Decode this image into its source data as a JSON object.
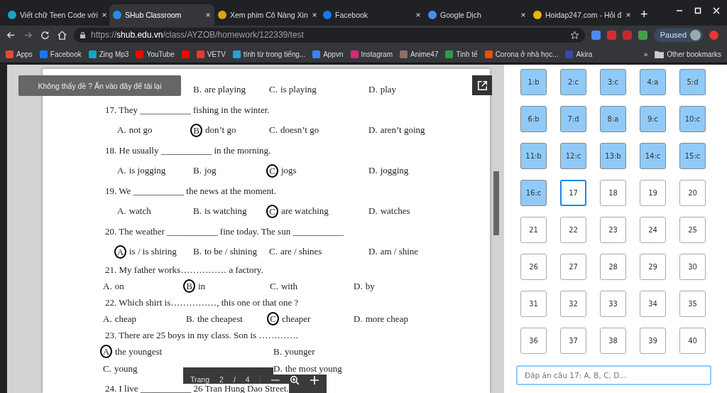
{
  "tabs": [
    {
      "title": "Viết chữ Teen Code với",
      "selected": false
    },
    {
      "title": "SHub Classroom",
      "selected": true
    },
    {
      "title": "Xem phim Cô Nàng Xin",
      "selected": false
    },
    {
      "title": "Facebook",
      "selected": false
    },
    {
      "title": "Google Dịch",
      "selected": false
    },
    {
      "title": "Hoidap247.com - Hỏi đ",
      "selected": false
    }
  ],
  "new_tab": "+",
  "address": {
    "scheme": "https://",
    "host": "shub.edu.vn",
    "path": "/class/AYZOB/homework/122339/test"
  },
  "profile": {
    "label": "Paused"
  },
  "bookmarks": [
    {
      "kind": "labeled",
      "label": "Apps"
    },
    {
      "kind": "labeled",
      "label": "Facebook"
    },
    {
      "kind": "labeled",
      "label": "Zing Mp3"
    },
    {
      "kind": "labeled",
      "label": "YouTube"
    },
    {
      "kind": "icon-only"
    },
    {
      "kind": "labeled",
      "label": "VETV"
    },
    {
      "kind": "labeled",
      "label": "tính từ trong tiếng..."
    },
    {
      "kind": "labeled",
      "label": "Appvn"
    },
    {
      "kind": "labeled",
      "label": "Instagram"
    },
    {
      "kind": "labeled",
      "label": "Anime47"
    },
    {
      "kind": "labeled",
      "label": "Tinh tế"
    },
    {
      "kind": "labeled",
      "label": "Corona ở nhà học..."
    },
    {
      "kind": "labeled",
      "label": "Akira"
    }
  ],
  "bookmarks_more": "»",
  "other_bookmarks": "Other bookmarks",
  "toast": "Không thấy đề ? Ấn vào đây để tải lại",
  "questions": [
    {
      "kind": "four-cut",
      "options": [
        {
          "label": "B.",
          "text": "are playing",
          "circled": false
        },
        {
          "label": "C.",
          "text": "is playing",
          "circled": false
        },
        {
          "label": "D.",
          "text": "play",
          "circled": false
        }
      ]
    },
    {
      "prompt": "17. They ___________ fishing in the winter.",
      "kind": "four",
      "options": [
        {
          "label": "A.",
          "text": "not go",
          "circled": false
        },
        {
          "label": "B",
          "text": "don’t go",
          "circled": true
        },
        {
          "label": "C.",
          "text": "doesn’t go",
          "circled": false
        },
        {
          "label": "D.",
          "text": "aren’t going",
          "circled": false
        }
      ]
    },
    {
      "prompt": "18. He usually ___________ in the morning.",
      "kind": "four",
      "options": [
        {
          "label": "A.",
          "text": "is jogging",
          "circled": false
        },
        {
          "label": "B.",
          "text": "jog",
          "circled": false
        },
        {
          "label": "C",
          "text": "jogs",
          "circled": true
        },
        {
          "label": "D.",
          "text": "jogging",
          "circled": false
        }
      ]
    },
    {
      "prompt": "19. We ___________ the news at the moment.",
      "kind": "four",
      "options": [
        {
          "label": "A.",
          "text": "watch",
          "circled": false
        },
        {
          "label": "B.",
          "text": "is watching",
          "circled": false
        },
        {
          "label": "C",
          "text": "are watching",
          "circled": true
        },
        {
          "label": "D.",
          "text": "watches",
          "circled": false
        }
      ]
    },
    {
      "prompt": "20. The weather ___________ fine today. The sun ___________",
      "kind": "four",
      "options": [
        {
          "label": "A",
          "text": "is / is shiring",
          "circled": true
        },
        {
          "label": "B.",
          "text": "to be / shining",
          "circled": false
        },
        {
          "label": "C.",
          "text": "are / shines",
          "circled": false
        },
        {
          "label": "D.",
          "text": "am / shine",
          "circled": false
        }
      ]
    },
    {
      "prompt": "21. My father works…………… a factory.",
      "kind": "compact",
      "options": [
        {
          "label": "A.",
          "text": "on",
          "circled": false
        },
        {
          "label": "B",
          "text": "in",
          "circled": true
        },
        {
          "label": "C.",
          "text": "with",
          "circled": false
        },
        {
          "label": "D.",
          "text": "by",
          "circled": false
        }
      ]
    },
    {
      "prompt": "22. Which shirt is……………, this one or that one ?",
      "kind": "compact",
      "options": [
        {
          "label": "A.",
          "text": "cheap",
          "circled": false
        },
        {
          "label": "B.",
          "text": "the cheapest",
          "circled": false
        },
        {
          "label": "C",
          "text": "cheaper",
          "circled": true
        },
        {
          "label": "D.",
          "text": "more cheap",
          "circled": false
        }
      ]
    },
    {
      "prompt": "23. There are 25 boys in my class. Son is ………….",
      "kind": "two",
      "options": [
        {
          "label": "A",
          "text": "the youngest",
          "circled": true
        },
        {
          "label": "B.",
          "text": "younger",
          "circled": false
        },
        {
          "label": "C.",
          "text": "young",
          "circled": false
        },
        {
          "label": "D.",
          "text": "the most young",
          "circled": false
        }
      ]
    },
    {
      "prompt": "24. I live ___________ 26 Tran Hung Dao Street.",
      "kind": "prompt-only"
    }
  ],
  "pager": {
    "label": "Trang",
    "page": "2",
    "separator": "/",
    "total": "4"
  },
  "answers": [
    {
      "label": "1:b",
      "answered": true,
      "selected": false
    },
    {
      "label": "2:c",
      "answered": true,
      "selected": false
    },
    {
      "label": "3:c",
      "answered": true,
      "selected": false
    },
    {
      "label": "4:a",
      "answered": true,
      "selected": false
    },
    {
      "label": "5:d",
      "answered": true,
      "selected": false
    },
    {
      "label": "6:b",
      "answered": true,
      "selected": false
    },
    {
      "label": "7:d",
      "answered": true,
      "selected": false
    },
    {
      "label": "8:a",
      "answered": true,
      "selected": false
    },
    {
      "label": "9:c",
      "answered": true,
      "selected": false
    },
    {
      "label": "10:c",
      "answered": true,
      "selected": false
    },
    {
      "label": "11:b",
      "answered": true,
      "selected": false
    },
    {
      "label": "12:c",
      "answered": true,
      "selected": false
    },
    {
      "label": "13:b",
      "answered": true,
      "selected": false
    },
    {
      "label": "14:c",
      "answered": true,
      "selected": false
    },
    {
      "label": "15:c",
      "answered": true,
      "selected": false
    },
    {
      "label": "16:c",
      "answered": true,
      "selected": false
    },
    {
      "label": "17",
      "answered": false,
      "selected": true
    },
    {
      "label": "18",
      "answered": false,
      "selected": false
    },
    {
      "label": "19",
      "answered": false,
      "selected": false
    },
    {
      "label": "20",
      "answered": false,
      "selected": false
    },
    {
      "label": "21",
      "answered": false,
      "selected": false
    },
    {
      "label": "22",
      "answered": false,
      "selected": false
    },
    {
      "label": "23",
      "answered": false,
      "selected": false
    },
    {
      "label": "24",
      "answered": false,
      "selected": false
    },
    {
      "label": "25",
      "answered": false,
      "selected": false
    },
    {
      "label": "26",
      "answered": false,
      "selected": false
    },
    {
      "label": "27",
      "answered": false,
      "selected": false
    },
    {
      "label": "28",
      "answered": false,
      "selected": false
    },
    {
      "label": "29",
      "answered": false,
      "selected": false
    },
    {
      "label": "30",
      "answered": false,
      "selected": false
    },
    {
      "label": "31",
      "answered": false,
      "selected": false
    },
    {
      "label": "32",
      "answered": false,
      "selected": false
    },
    {
      "label": "33",
      "answered": false,
      "selected": false
    },
    {
      "label": "34",
      "answered": false,
      "selected": false
    },
    {
      "label": "35",
      "answered": false,
      "selected": false
    },
    {
      "label": "36",
      "answered": false,
      "selected": false
    },
    {
      "label": "37",
      "answered": false,
      "selected": false
    },
    {
      "label": "38",
      "answered": false,
      "selected": false
    },
    {
      "label": "39",
      "answered": false,
      "selected": false
    },
    {
      "label": "40",
      "answered": false,
      "selected": false
    }
  ],
  "answer_input": {
    "placeholder": "Đáp án câu 17: A, B, C, D..."
  }
}
